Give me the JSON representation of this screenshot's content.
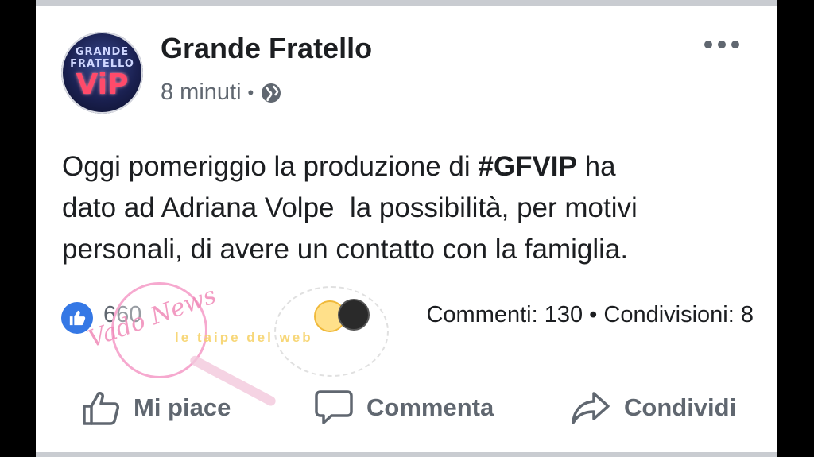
{
  "post": {
    "page_name": "Grande Fratello",
    "avatar": {
      "line1": "GRANDE",
      "line2": "FRATELLO",
      "line3": "ViP"
    },
    "time": "8 minuti",
    "separator": "•",
    "text_before_tag": "Oggi pomeriggio la produzione di ",
    "hashtag": "#GFVIP",
    "text_after_tag": " ha\ndato ad Adriana Volpe  la possibilità, per motivi\npersonali, di avere un contatto con la famiglia.",
    "more_icon": "more-horizontal-icon",
    "privacy_icon": "globe-icon"
  },
  "reactions": {
    "count": "660",
    "icon": "like-icon"
  },
  "stats": {
    "text": "Commenti: 130 • Condivisioni: 8"
  },
  "actions": {
    "like": "Mi piace",
    "comment": "Commenta",
    "share": "Condividi"
  },
  "watermark": {
    "script": "Vado News",
    "ribbon": "le taipe del web"
  },
  "colors": {
    "accent": "#3578e5",
    "text": "#1c1e21",
    "muted": "#606770",
    "watermark_pink": "#f08ab8"
  }
}
